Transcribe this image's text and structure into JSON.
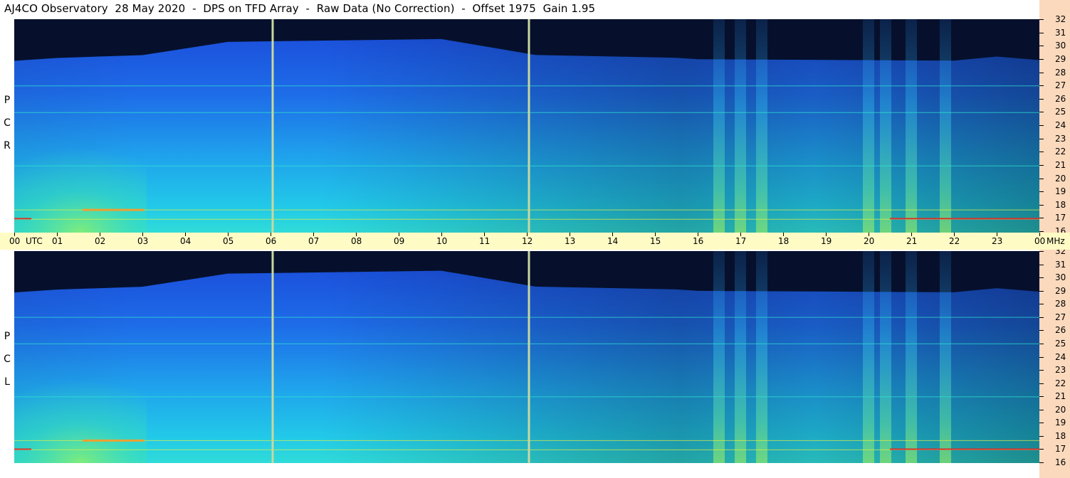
{
  "title": "AJ4CO Observatory  28 May 2020  -  DPS on TFD Array  -  Raw Data (No Correction)  -  Offset 1975  Gain 1.95",
  "panels": [
    {
      "id": "rcp",
      "label": [
        "R",
        "C",
        "P"
      ]
    },
    {
      "id": "lcp",
      "label": [
        "L",
        "C",
        "P"
      ]
    }
  ],
  "chart_data": {
    "type": "heatmap",
    "title": "AJ4CO Observatory  28 May 2020  -  DPS on TFD Array  -  Raw Data (No Correction)  -  Offset 1975  Gain 1.95",
    "xlabel": "UTC",
    "ylabel": "MHz",
    "x_ticks": [
      "00",
      "01",
      "02",
      "03",
      "04",
      "05",
      "06",
      "07",
      "08",
      "09",
      "10",
      "11",
      "12",
      "13",
      "14",
      "15",
      "16",
      "17",
      "18",
      "19",
      "20",
      "21",
      "22",
      "23",
      "00"
    ],
    "x_range": [
      0,
      24
    ],
    "y_ticks": [
      "16",
      "17",
      "18",
      "19",
      "20",
      "21",
      "22",
      "23",
      "24",
      "25",
      "26",
      "27",
      "28",
      "29",
      "30",
      "31",
      "32"
    ],
    "y_range": [
      16,
      32
    ],
    "units": {
      "x": "UTC",
      "y": "MHz"
    },
    "subplots": [
      "RCP",
      "LCP"
    ],
    "features": {
      "calibration_lines_utc": [
        6.05,
        12.05
      ],
      "persistent_lines_mhz": [
        17.0,
        17.7,
        21.0,
        25.0,
        27.0
      ],
      "vertical_bursts_utc": [
        16.5,
        17.0,
        17.5,
        20.0,
        20.4,
        21.0,
        21.8
      ],
      "sky_background_ceiling_mhz": {
        "night": 29.2,
        "day": 30.3,
        "evening": 29.0
      }
    }
  }
}
